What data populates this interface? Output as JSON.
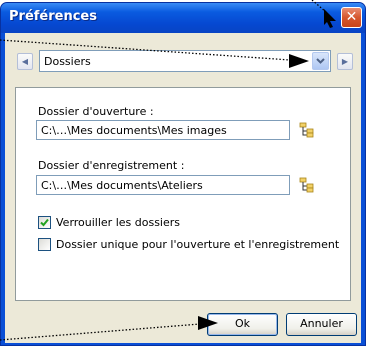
{
  "window": {
    "title": "Préférences"
  },
  "nav": {
    "selected": "Dossiers"
  },
  "fields": [
    {
      "label": "Dossier d'ouverture :",
      "value": "C:\\…\\Mes documents\\Mes images"
    },
    {
      "label": "Dossier d'enregistrement :",
      "value": "C:\\…\\Mes documents\\Ateliers"
    }
  ],
  "checks": [
    {
      "label": "Verrouiller les dossiers",
      "checked": true
    },
    {
      "label": "Dossier unique pour l'ouverture et l'enregistrement",
      "checked": false
    }
  ],
  "buttons": {
    "ok": "Ok",
    "cancel": "Annuler"
  },
  "colors": {
    "title_bar": "#0a5be0",
    "close": "#d6572e",
    "face": "#ece9d8"
  },
  "icons": [
    "close-icon",
    "arrow-left-icon",
    "arrow-right-icon",
    "chevron-down-icon",
    "folder-tree-icon",
    "check-icon",
    "pointer-arrow-icon"
  ]
}
